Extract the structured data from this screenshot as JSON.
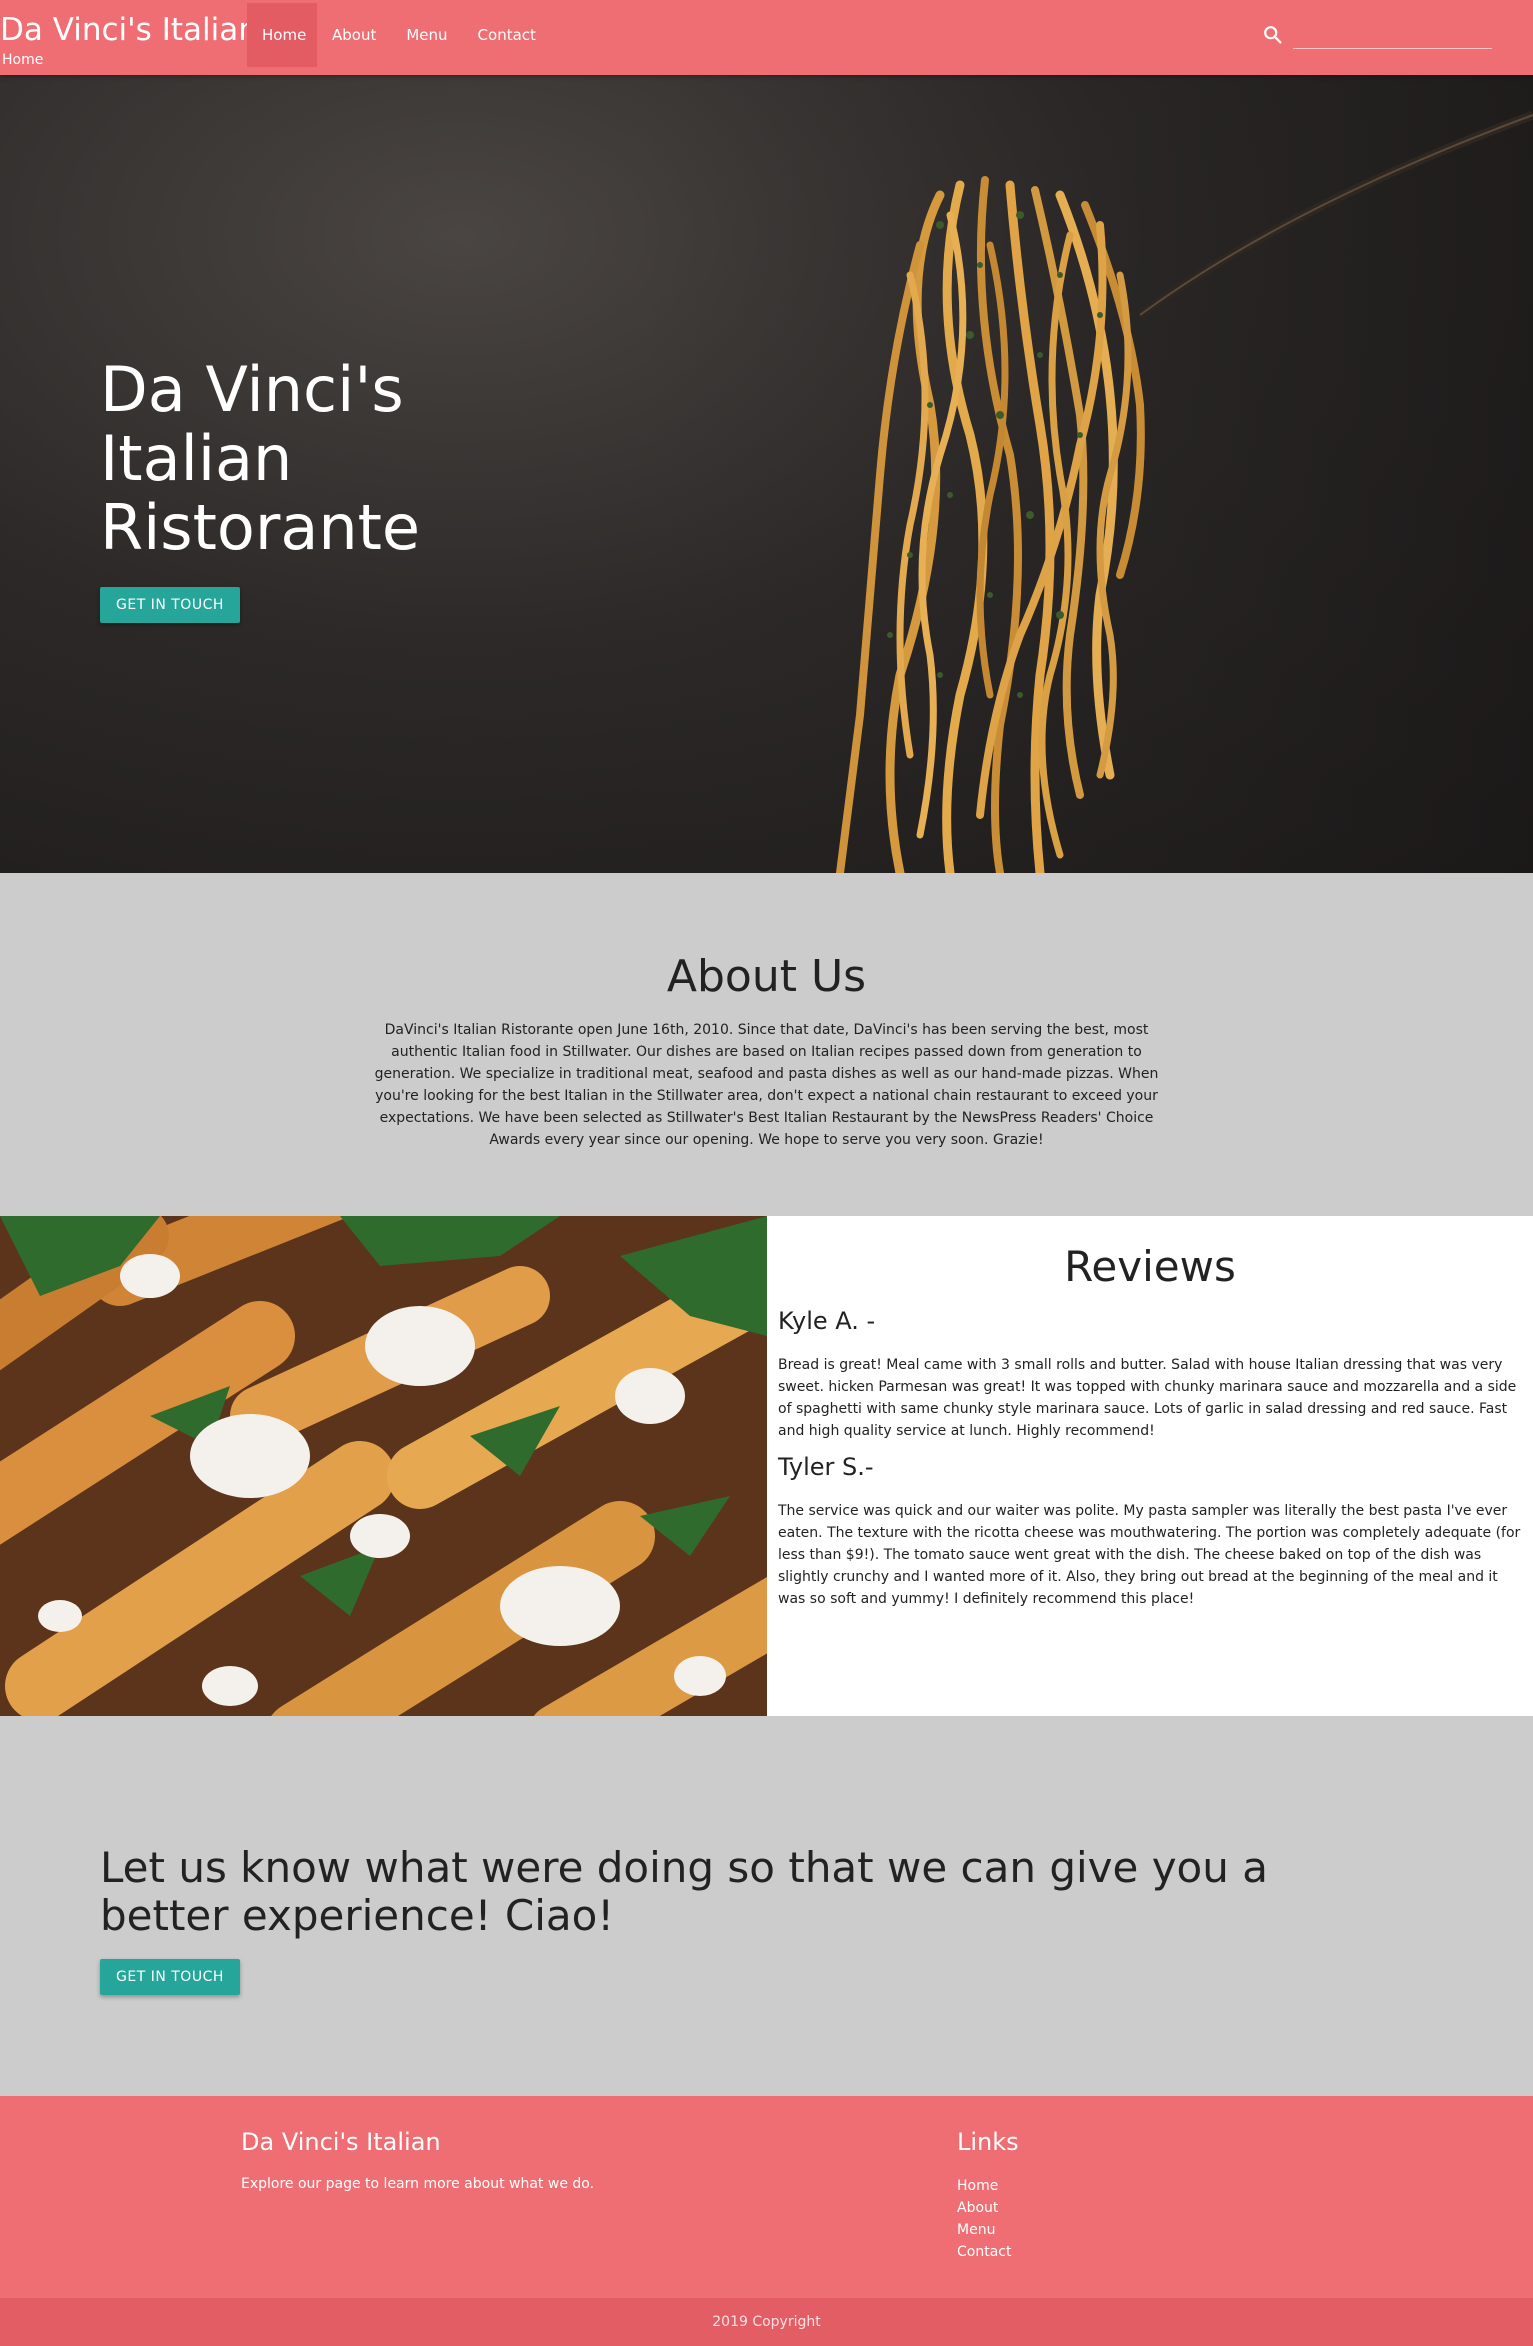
{
  "nav": {
    "brand": "Da Vinci's Italian",
    "brand_sub": "Home",
    "links": [
      "Home",
      "About",
      "Menu",
      "Contact"
    ],
    "search_value": ""
  },
  "hero": {
    "title": "Da Vinci's Italian Ristorante",
    "button": "Get in Touch"
  },
  "about": {
    "title": "About Us",
    "text": "DaVinci's Italian Ristorante open June 16th, 2010. Since that date, DaVinci's has been serving the best, most authentic Italian food in Stillwater. Our dishes are based on Italian recipes passed down from generation to generation. We specialize in traditional meat, seafood and pasta dishes as well as our hand-made pizzas. When you're looking for the best Italian in the Stillwater area, don't expect a national chain restaurant to exceed your expectations. We have been selected as Stillwater's Best Italian Restaurant by the NewsPress Readers' Choice Awards every year since our opening. We hope to serve you very soon. Grazie!"
  },
  "reviews": {
    "title": "Reviews",
    "items": [
      {
        "name": "Kyle A. -",
        "text": "Bread is great! Meal came with 3 small rolls and butter. Salad with house Italian dressing that was very sweet. hicken Parmesan was great! It was topped with chunky marinara sauce and mozzarella and a side of spaghetti with same chunky style marinara sauce. Lots of garlic in salad dressing and red sauce. Fast and high quality service at lunch. Highly recommend!"
      },
      {
        "name": "Tyler S.-",
        "text": "The service was quick and our waiter was polite. My pasta sampler was literally the best pasta I've ever eaten. The texture with the ricotta cheese was mouthwatering. The portion was completely adequate (for less than $9!). The tomato sauce went great with the dish. The cheese baked on top of the dish was slightly crunchy and I wanted more of it. Also, they bring out bread at the beginning of the meal and it was so soft and yummy! I definitely recommend this place!"
      }
    ]
  },
  "cta": {
    "title": "Let us know what were doing so that we can give you a better experience! Ciao!",
    "button": "Get in Touch"
  },
  "footer": {
    "title": "Da Vinci's Italian",
    "text": "Explore our page to learn more about what we do.",
    "links_title": "Links",
    "links": [
      "Home",
      "About",
      "Menu",
      "Contact"
    ],
    "copyright": "2019 Copyright"
  },
  "colors": {
    "primary": "#ef6e73",
    "accent": "#26a69a",
    "section_bg": "#cccccc"
  }
}
